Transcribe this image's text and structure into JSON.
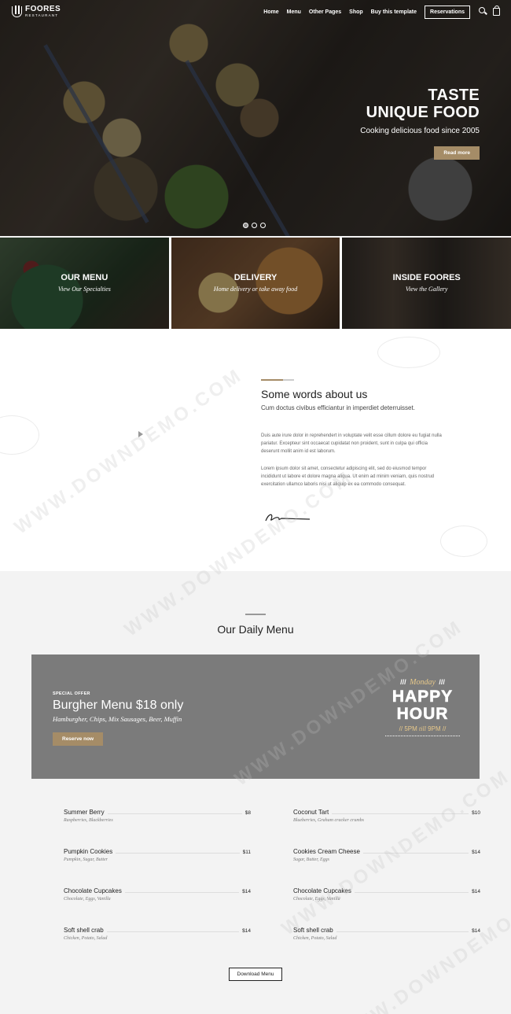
{
  "nav": {
    "brand": "FOORES",
    "brand_sub": "RESTAURANT",
    "links": [
      "Home",
      "Menu",
      "Other Pages",
      "Shop",
      "Buy this template"
    ],
    "reservations": "Reservations"
  },
  "hero": {
    "title_line1": "TASTE",
    "title_line2": "UNIQUE FOOD",
    "subtitle": "Cooking delicious food since 2005",
    "button": "Read more"
  },
  "tiles": [
    {
      "title": "OUR MENU",
      "subtitle": "View Our Specialties"
    },
    {
      "title": "DELIVERY",
      "subtitle": "Home delivery or take away food"
    },
    {
      "title": "INSIDE FOORES",
      "subtitle": "View the Gallery"
    }
  ],
  "about": {
    "title": "Some words about us",
    "lead": "Cum doctus civibus efficiantur in imperdiet deterruisset.",
    "p1": "Duis aute irure dolor in reprehendert in voluptate velit esse cillum dolore eu fugiat nulla pariatur. Excepteur sint occaecat cupidatat non proident, sunt in culpa qui officia deserunt mollit anim id est laborum.",
    "p2": "Lorem ipsum dolor sit amet, consectetur adipiscing elit, sed do eiusmod tempor incididunt ut labore et dolore magna aliqua. Ut enim ad minim veniam, quis nostrud exercitation ullamco laboris nisi ut aliquip ex ea commodo consequat."
  },
  "daily": {
    "title": "Our Daily Menu",
    "offer": {
      "tag": "SPECIAL OFFER",
      "title": "Burgher Menu $18 only",
      "desc": "Hamburgher, Chips, Mix Sausages, Beer, Muffin",
      "button": "Reserve now"
    },
    "happy_hour": {
      "day": "Monday",
      "line1": "HAPPY",
      "line2": "HOUR",
      "start": "5PM",
      "till": "till",
      "end": "9PM"
    },
    "items": [
      {
        "name": "Summer Berry",
        "price": "$8",
        "ingredients": "Raspberries, Blackberries"
      },
      {
        "name": "Coconut Tart",
        "price": "$10",
        "ingredients": "Blueberries, Graham cracker crumbs"
      },
      {
        "name": "Pumpkin Cookies",
        "price": "$11",
        "ingredients": "Pumpkin, Sugar, Butter"
      },
      {
        "name": "Cookies Cream Cheese",
        "price": "$14",
        "ingredients": "Sugar, Butter, Eggs"
      },
      {
        "name": "Chocolate Cupcakes",
        "price": "$14",
        "ingredients": "Chocolate, Eggs, Vanilla"
      },
      {
        "name": "Chocolate Cupcakes",
        "price": "$14",
        "ingredients": "Chocolate, Eggs, Vanilla"
      },
      {
        "name": "Soft shell crab",
        "price": "$14",
        "ingredients": "Chicken, Potato, Salad"
      },
      {
        "name": "Soft shell crab",
        "price": "$14",
        "ingredients": "Chicken, Potato, Salad"
      }
    ],
    "download": "Download Menu"
  },
  "watermark": "WWW.DOWNDEMO.COM",
  "colors": {
    "accent": "#a58c67",
    "offer_bg": "#7b7b7b"
  }
}
